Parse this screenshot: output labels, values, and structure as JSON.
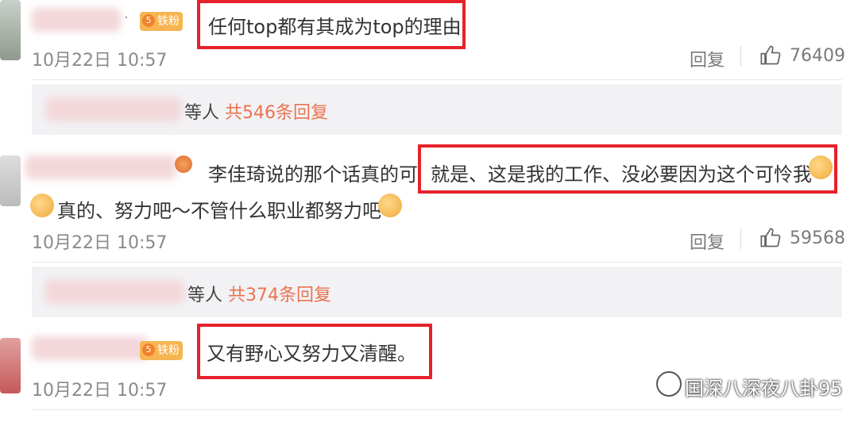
{
  "comments": [
    {
      "badge": "铁粉",
      "dash": "·",
      "text": "任何top都有其成为top的理由",
      "time": "10月22日 10:57",
      "reply_label": "回复",
      "likes": "76409",
      "summary": {
        "suffix": "等人",
        "count_text": "共546条回复"
      }
    },
    {
      "text_part1": "李佳琦说的那个话真的可",
      "text_highlight": "就是、这是我的工作、没必要因为这个可怜我",
      "text_line2": "真的、努力吧～不管什么职业都努力吧",
      "time": "10月22日 10:57",
      "reply_label": "回复",
      "likes": "59568",
      "summary": {
        "suffix": "等人",
        "count_text": "共374条回复"
      }
    },
    {
      "badge": "铁粉",
      "text": "又有野心又努力又清醒。",
      "time": "10月22日 10:57"
    }
  ],
  "watermark": "国深八深夜八卦95",
  "colors": {
    "highlight_box": "#e6212a",
    "reply_count": "#eb7350",
    "badge": "#f6b552"
  },
  "icons": {
    "like": "thumbs-up-icon",
    "crown": "crown-icon",
    "emoji_thumbs": "thumbs-up-emoji",
    "emoji_muscle": "muscle-emoji"
  }
}
